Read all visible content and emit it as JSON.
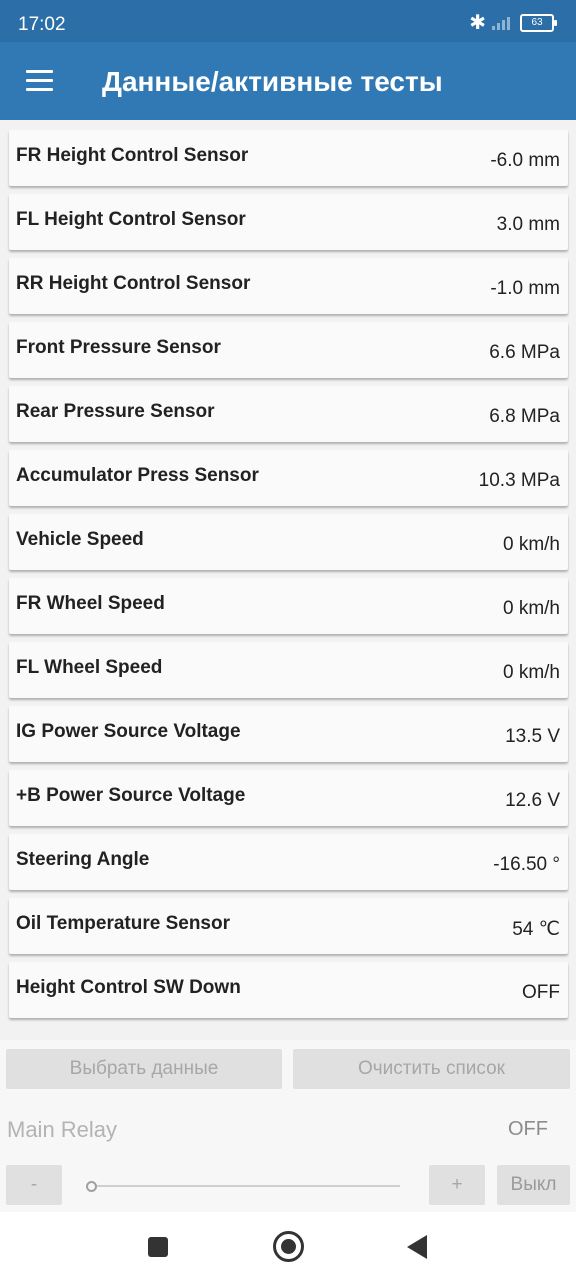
{
  "status_bar": {
    "time": "17:02",
    "battery": "63"
  },
  "app_bar": {
    "title": "Данные/активные тесты"
  },
  "items": [
    {
      "label": "FR Height Control Sensor",
      "value": "-6.0 mm"
    },
    {
      "label": "FL Height Control Sensor",
      "value": "3.0 mm"
    },
    {
      "label": "RR Height Control Sensor",
      "value": "-1.0 mm"
    },
    {
      "label": "Front Pressure Sensor",
      "value": "6.6 MPa"
    },
    {
      "label": "Rear Pressure Sensor",
      "value": "6.8 MPa"
    },
    {
      "label": "Accumulator Press Sensor",
      "value": "10.3 MPa"
    },
    {
      "label": "Vehicle Speed",
      "value": "0 km/h"
    },
    {
      "label": "FR Wheel Speed",
      "value": "0 km/h"
    },
    {
      "label": "FL Wheel Speed",
      "value": "0 km/h"
    },
    {
      "label": "IG Power Source Voltage",
      "value": "13.5 V"
    },
    {
      "label": "+B Power Source Voltage",
      "value": "12.6 V"
    },
    {
      "label": "Steering Angle",
      "value": "-16.50 °"
    },
    {
      "label": "Oil Temperature Sensor",
      "value": "54 ℃"
    },
    {
      "label": "Height Control SW Down",
      "value": "OFF"
    }
  ],
  "bottom": {
    "select_button": "Выбрать данные",
    "clear_button": "Очистить список",
    "relay_label": "Main Relay",
    "relay_value": "OFF",
    "minus_button": "-",
    "plus_button": "+",
    "off_button": "Выкл",
    "slider_level": 0
  }
}
